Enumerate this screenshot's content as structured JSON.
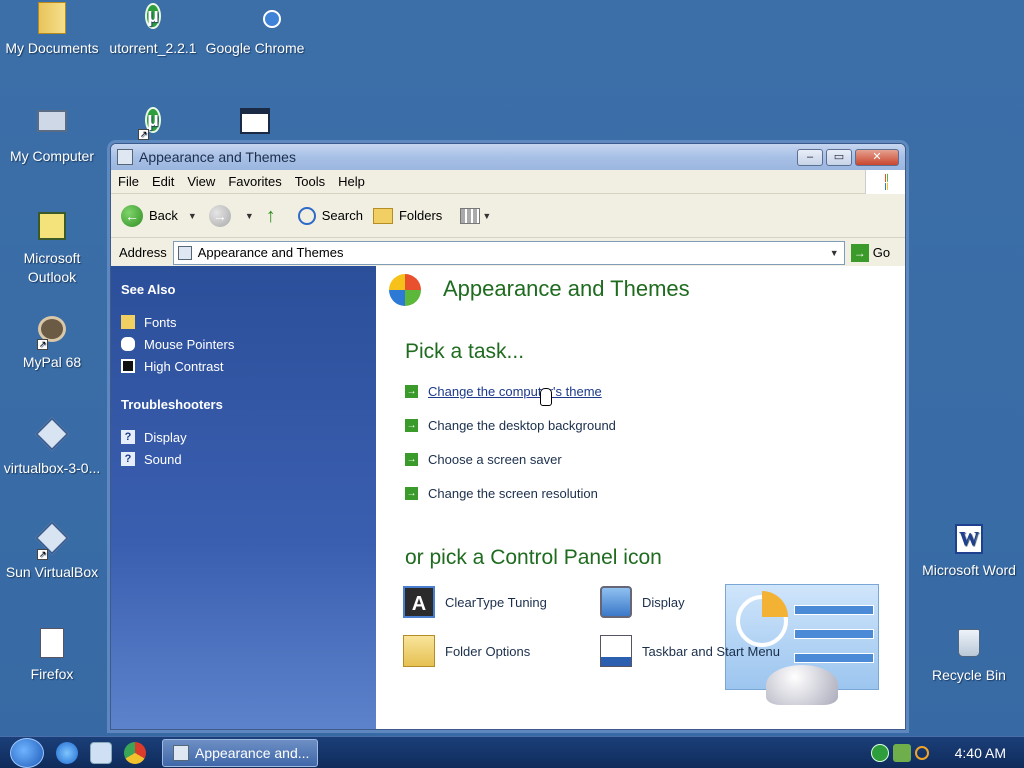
{
  "desktop": {
    "icons": [
      {
        "label": "My Documents",
        "icon": "folder-icon"
      },
      {
        "label": "utorrent_2.2.1",
        "icon": "utorrent-icon"
      },
      {
        "label": "Google Chrome",
        "icon": "chrome-icon"
      },
      {
        "label": "My Computer",
        "icon": "computer-icon"
      },
      {
        "label": "Microsoft Outlook",
        "icon": "outlook-icon"
      },
      {
        "label": "MyPal 68",
        "icon": "mypal-icon"
      },
      {
        "label": "virtualbox-3-0...",
        "icon": "virtualbox-icon"
      },
      {
        "label": "Sun VirtualBox",
        "icon": "virtualbox-icon"
      },
      {
        "label": "Firefox",
        "icon": "firefox-icon"
      },
      {
        "label": "Microsoft Word",
        "icon": "word-icon"
      },
      {
        "label": "Recycle Bin",
        "icon": "recycle-bin-icon"
      }
    ]
  },
  "window": {
    "title": "Appearance and Themes",
    "menu": [
      "File",
      "Edit",
      "View",
      "Favorites",
      "Tools",
      "Help"
    ],
    "toolbar": {
      "back": "Back",
      "search": "Search",
      "folders": "Folders"
    },
    "address": {
      "label": "Address",
      "value": "Appearance and Themes",
      "go": "Go"
    },
    "sidebar": {
      "see_also_title": "See Also",
      "see_also": [
        "Fonts",
        "Mouse Pointers",
        "High Contrast"
      ],
      "troubleshooters_title": "Troubleshooters",
      "troubleshooters": [
        "Display",
        "Sound"
      ]
    },
    "main": {
      "title": "Appearance and Themes",
      "pick_task": "Pick a task...",
      "tasks": [
        "Change the computer's theme",
        "Change the desktop background",
        "Choose a screen saver",
        "Change the screen resolution"
      ],
      "pick_icon": "or pick a Control Panel icon",
      "cp_icons": [
        "ClearType Tuning",
        "Display",
        "Folder Options",
        "Taskbar and Start Menu"
      ]
    }
  },
  "taskbar": {
    "active_task": "Appearance and...",
    "clock": "4:40 AM"
  },
  "colors": {
    "desktop": "#3a6ea5",
    "sidebar": "#2c4f9a",
    "heading": "#1f6b1f"
  }
}
